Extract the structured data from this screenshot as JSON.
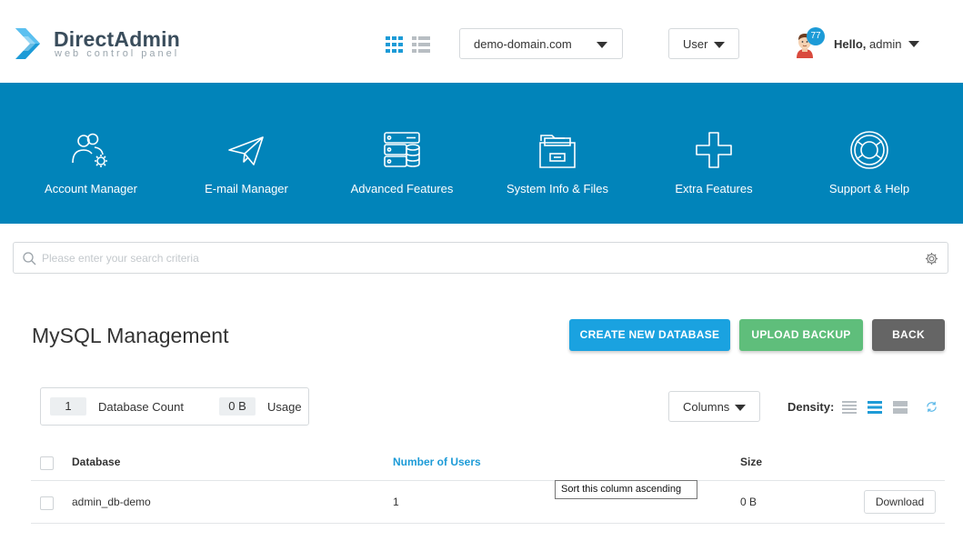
{
  "header": {
    "brand": "DirectAdmin",
    "brand_sub": "web control panel",
    "domain_select": "demo-domain.com",
    "role_select": "User",
    "notifications": "77",
    "greeting": "Hello,",
    "username": "admin"
  },
  "nav": [
    {
      "label": "Account Manager",
      "icon": "users-gear-icon"
    },
    {
      "label": "E-mail Manager",
      "icon": "paper-plane-icon"
    },
    {
      "label": "Advanced Features",
      "icon": "server-database-icon"
    },
    {
      "label": "System Info & Files",
      "icon": "folder-icon"
    },
    {
      "label": "Extra Features",
      "icon": "plus-icon"
    },
    {
      "label": "Support & Help",
      "icon": "lifebuoy-icon"
    }
  ],
  "search": {
    "placeholder": "Please enter your search criteria"
  },
  "main": {
    "title": "MySQL Management",
    "buttons": {
      "create": "CREATE NEW DATABASE",
      "upload": "UPLOAD BACKUP",
      "back": "BACK"
    },
    "stats": {
      "count_value": "1",
      "count_label": "Database Count",
      "usage_value": "0 B",
      "usage_label": "Usage"
    },
    "columns_label": "Columns",
    "density_label": "Density:",
    "density_selected": "medium",
    "table": {
      "headers": [
        "Database",
        "Number of Users",
        "Size"
      ],
      "rows": [
        {
          "database": "admin_db-demo",
          "users": "1",
          "size": "0 B",
          "action": "Download"
        }
      ]
    },
    "tooltip": "Sort this column ascending"
  },
  "colors": {
    "nav_bg": "#0184ba",
    "accent": "#1aa2e0",
    "upload": "#5fbe7b",
    "back": "#656565"
  }
}
